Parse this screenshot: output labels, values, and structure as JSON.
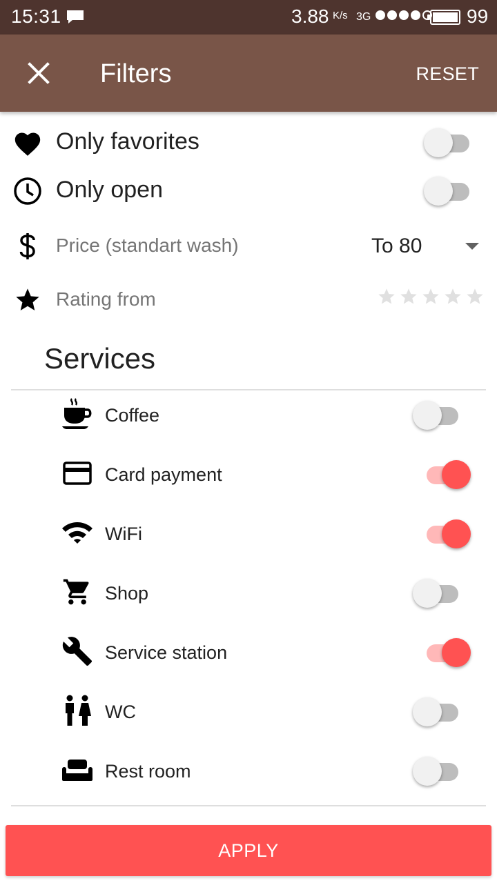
{
  "status_bar": {
    "time": "15:31",
    "speed": "3.88",
    "speed_unit": "K/s",
    "network": "3G",
    "battery": "99",
    "signal_bars_filled": 4,
    "signal_bars_total": 5
  },
  "app_bar": {
    "title": "Filters",
    "reset_label": "RESET",
    "close_icon": "close-icon",
    "background_color": "#795548"
  },
  "filters": {
    "favorites": {
      "label": "Only favorites",
      "icon": "heart-icon",
      "enabled": false
    },
    "open": {
      "label": "Only open",
      "icon": "clock-icon",
      "enabled": false
    },
    "price": {
      "label": "Price (standart wash)",
      "icon": "dollar-icon",
      "value": "To 80"
    },
    "rating": {
      "label": "Rating from",
      "icon": "star-icon",
      "stars_total": 5,
      "stars_selected": 0
    }
  },
  "services": {
    "title": "Services",
    "items": [
      {
        "label": "Coffee",
        "icon": "coffee-icon",
        "enabled": false
      },
      {
        "label": "Card payment",
        "icon": "credit-card-icon",
        "enabled": true
      },
      {
        "label": "WiFi",
        "icon": "wifi-icon",
        "enabled": true
      },
      {
        "label": "Shop",
        "icon": "shopping-cart-icon",
        "enabled": false
      },
      {
        "label": "Service station",
        "icon": "wrench-icon",
        "enabled": true
      },
      {
        "label": "WC",
        "icon": "wc-icon",
        "enabled": false
      },
      {
        "label": "Rest room",
        "icon": "sofa-icon",
        "enabled": false
      }
    ]
  },
  "apply_label": "APPLY",
  "colors": {
    "accent": "#ff5252",
    "accent_track": "#ffb8b8",
    "status_bar": "#4e342e"
  }
}
